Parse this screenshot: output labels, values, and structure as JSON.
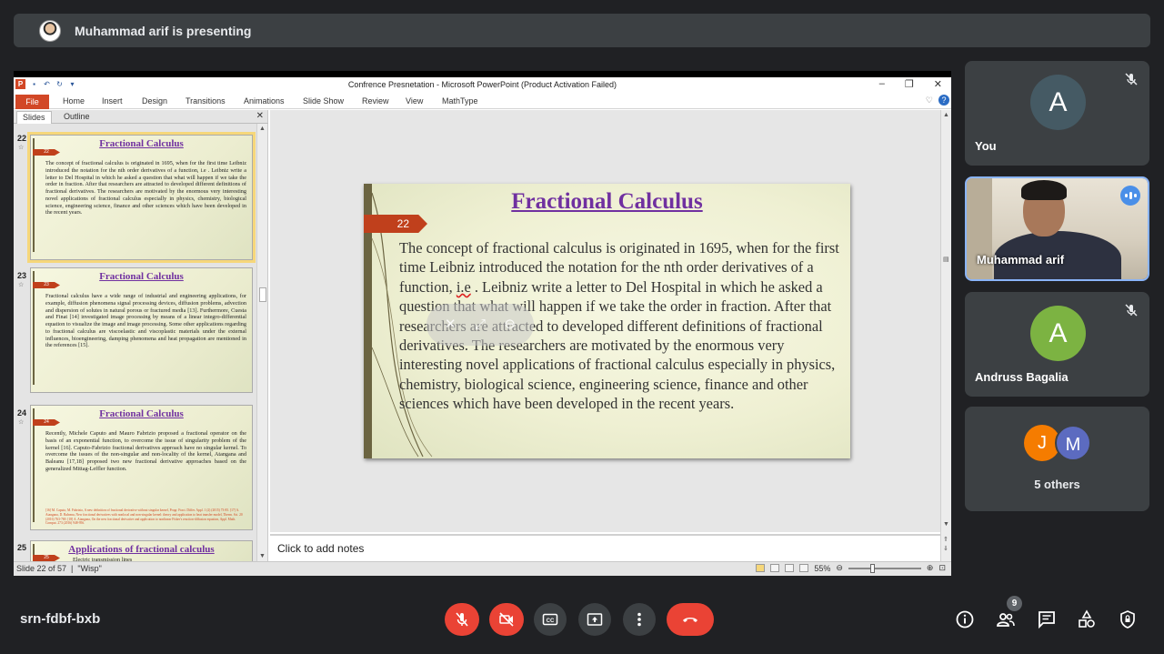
{
  "presenting_bar": {
    "label": "Muhammad arif is presenting"
  },
  "app": {
    "window_title": "Confrence Presnetation  -  Microsoft PowerPoint (Product Activation Failed)",
    "ribbon_tabs": [
      "File",
      "Home",
      "Insert",
      "Design",
      "Transitions",
      "Animations",
      "Slide Show",
      "Review",
      "View",
      "MathType"
    ],
    "panel_tabs": {
      "slides": "Slides",
      "outline": "Outline"
    },
    "status_slide": "Slide 22 of 57",
    "status_theme": "\"Wisp\"",
    "zoom": "55%",
    "notes_placeholder": "Click to add notes"
  },
  "thumbnails": [
    {
      "num": "22",
      "tag": "22",
      "title": "Fractional  Calculus",
      "body": "The concept of fractional calculus is originated in 1695, when for the first time Leibniz introduced the notation for the nth order derivatives of a function, i.e  . Leibniz write a letter to Del Hospital in which he asked a question that what will happen if we take the order in fraction. After that researchers are attracted to developed different definitions of fractional derivatives. The researchers are motivated by the enormous very interesting novel applications of fractional calculus especially in physics, chemistry, biological science, engineering science, finance and other sciences which have been developed in the recent years.",
      "refs": ""
    },
    {
      "num": "23",
      "tag": "23",
      "title": "Fractional  Calculus",
      "body": "Fractional calculus have a wide range of industrial and engineering applications, for example, diffusion phenomena signal processing devices, diffusion problems, advection and dispersion of solutes in natural porous or fractured media [13]. Furthermore, Cuesta and Finat [14] investigated image processing by means of a linear integro-differential equation to visualize the image and image processing. Some other applications regarding to fractional calculus are viscoelastic and viscoplastic materials under the external influences, bioengineering, damping phenomena and heat propagation are mentioned in the references [15].",
      "refs": ""
    },
    {
      "num": "24",
      "tag": "24",
      "title": "Fractional  Calculus",
      "body": "Recently, Michele Caputo and Mauro Fabrizio proposed a fractional operator on the basis of an exponential function, to overcome the issue of singularity problem of the kernel [16]. Caputo-Fabrizio fractional derivatives approach have no singular kernel. To overcome the issues of the non-singular and non-locality of the kernel, Atangana and Baleanu [17,18] proposed two new fractional derivative approaches based on the generalized Mittag-Leffler function.",
      "refs": "[16] M. Caputo, M. Fabrizio, A new definition of fractional derivative without singular kernel, Progr. Fract. Differ. Appl. 1 (2) (2015) 73-85. [17] A. Atangana, D. Baleanu, New fractional derivatives with nonlocal and non-singular kernel: theory and application to heat transfer model, Therm. Sci. 20 (2016) 763-769. [18] A. Atangana, On the new fractional derivative and application to nonlinear Fisher's reaction-diffusion equation, Appl. Math. Comput. 273 (2016) 948-956."
    },
    {
      "num": "25",
      "tag": "25",
      "title": "Applications of fractional calculus",
      "body": "Electric transmission lines",
      "refs": ""
    }
  ],
  "slide": {
    "number": "22",
    "title": "Fractional Calculus",
    "body_before": "The concept of fractional calculus is originated in 1695, when for the first time Leibniz introduced the notation for the nth order derivatives of a function, ",
    "body_ie": "i.e",
    "body_after": "  . Leibniz write a letter to Del Hospital in which he asked a question that what will happen if we take the order in fraction. After that researchers are attracted to developed different definitions of fractional derivatives. The researchers are motivated by the enormous very interesting novel applications of fractional calculus especially in physics, chemistry, biological science, engineering science, finance and other sciences which have been developed in the recent years."
  },
  "participants": [
    {
      "name": "You",
      "initial": "A",
      "color": "#455a64",
      "muted": true
    },
    {
      "name": "Muhammad arif",
      "video": true,
      "speaking": true
    },
    {
      "name": "Andruss Bagalia",
      "initial": "A",
      "color": "#7cb342",
      "muted": true
    },
    {
      "label": "5 others",
      "initials": [
        "J",
        "M"
      ],
      "colors": [
        "#f57c00",
        "#5c6bc0"
      ]
    }
  ],
  "meeting": {
    "code": "srn-fdbf-bxb",
    "people_count": "9",
    "controls": [
      "mic-off",
      "camera-off",
      "captions",
      "present",
      "more",
      "leave"
    ],
    "accent_red": "#ea4335"
  }
}
